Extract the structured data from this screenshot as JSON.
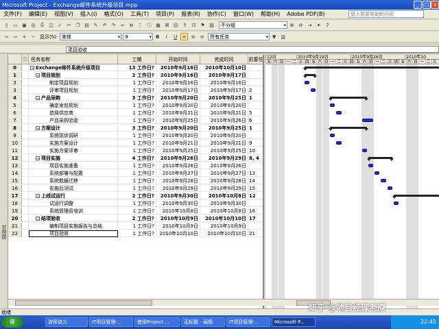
{
  "window": {
    "title": "Microsoft Project - Exchange邮件系统升级项目.mpp"
  },
  "menu": [
    "文件(F)",
    "编辑(E)",
    "视图(V)",
    "插入(I)",
    "格式(O)",
    "工具(T)",
    "项目(P)",
    "报表(R)",
    "协作(C)",
    "窗口(W)",
    "帮助(H)",
    "Adobe PDF(B)"
  ],
  "help_placeholder": "键入需要帮助的问题",
  "toolbar": {
    "group_value": "不分组",
    "show_label": "显示(S)·",
    "font": "宋体",
    "size": "9",
    "filter": "所有任务"
  },
  "entry_bar": {
    "value": "项目验收"
  },
  "columns": {
    "info": "ⓘ",
    "name": "任务名称",
    "duration": "工期",
    "start": "开始时间",
    "finish": "完成时间",
    "pred": "前置任"
  },
  "tasks": [
    {
      "id": "0",
      "name": "Exchange邮件系统升级项目",
      "duration": "13 工作日?",
      "start": "2010年9月16日",
      "finish": "2010年10月10日",
      "pred": "",
      "level": 0,
      "summary": true
    },
    {
      "id": "1",
      "name": "项目规划",
      "duration": "2 工作日?",
      "start": "2010年9月16日",
      "finish": "2010年9月17日",
      "pred": "",
      "level": 1,
      "summary": true
    },
    {
      "id": "2",
      "name": "制定项目规划",
      "duration": "1 工作日?",
      "start": "2010年9月16日",
      "finish": "2010年9月16日",
      "pred": "",
      "level": 2,
      "summary": false
    },
    {
      "id": "3",
      "name": "评审项目规划",
      "duration": "1 工作日?",
      "start": "2010年9月17日",
      "finish": "2010年9月17日",
      "pred": "2",
      "level": 2,
      "summary": false
    },
    {
      "id": "4",
      "name": "产品采购",
      "duration": "3 工作日?",
      "start": "2010年9月20日",
      "finish": "2010年9月25日",
      "pred": "1",
      "level": 1,
      "summary": true
    },
    {
      "id": "5",
      "name": "确定发包规划",
      "duration": "1 工作日?",
      "start": "2010年9月20日",
      "finish": "2010年9月20日",
      "pred": "",
      "level": 2,
      "summary": false
    },
    {
      "id": "6",
      "name": "选择供应商",
      "duration": "1 工作日?",
      "start": "2010年9月21日",
      "finish": "2010年9月21日",
      "pred": "5",
      "level": 2,
      "summary": false
    },
    {
      "id": "7",
      "name": "产品采购验收",
      "duration": "1 工作日?",
      "start": "2010年9月25日",
      "finish": "2010年9月26日",
      "pred": "6",
      "level": 2,
      "summary": false
    },
    {
      "id": "8",
      "name": "方案设计",
      "duration": "3 工作日?",
      "start": "2010年9月20日",
      "finish": "2010年9月25日",
      "pred": "1",
      "level": 1,
      "summary": true
    },
    {
      "id": "9",
      "name": "系统现状调研",
      "duration": "1 工作日?",
      "start": "2010年9月20日",
      "finish": "2010年9月20日",
      "pred": "",
      "level": 2,
      "summary": false
    },
    {
      "id": "10",
      "name": "实施方案设计",
      "duration": "1 工作日?",
      "start": "2010年9月21日",
      "finish": "2010年9月21日",
      "pred": "9",
      "level": 2,
      "summary": false
    },
    {
      "id": "11",
      "name": "实施方案评审",
      "duration": "1 工作日?",
      "start": "2010年9月25日",
      "finish": "2010年9月25日",
      "pred": "10",
      "level": 2,
      "summary": false
    },
    {
      "id": "12",
      "name": "项目实施",
      "duration": "4 工作日?",
      "start": "2010年9月26日",
      "finish": "2010年9月29日",
      "pred": "8, 4",
      "level": 1,
      "summary": true
    },
    {
      "id": "13",
      "name": "项目实施准备",
      "duration": "1 工作日?",
      "start": "2010年9月26日",
      "finish": "2010年9月26日",
      "pred": "",
      "level": 2,
      "summary": false
    },
    {
      "id": "14",
      "name": "系统部署与配置",
      "duration": "1 工作日?",
      "start": "2010年9月27日",
      "finish": "2010年9月27日",
      "pred": "13",
      "level": 2,
      "summary": false
    },
    {
      "id": "15",
      "name": "系统数据迁移",
      "duration": "1 工作日?",
      "start": "2010年9月28日",
      "finish": "2010年9月28日",
      "pred": "14",
      "level": 2,
      "summary": false
    },
    {
      "id": "16",
      "name": "实施后测试",
      "duration": "1 工作日?",
      "start": "2010年9月29日",
      "finish": "2010年9月29日",
      "pred": "15",
      "level": 2,
      "summary": false
    },
    {
      "id": "17",
      "name": "上线试运行",
      "duration": "2 工作日?",
      "start": "2010年9月30日",
      "finish": "2010年10月8日",
      "pred": "12",
      "level": 1,
      "summary": true
    },
    {
      "id": "18",
      "name": "试运行调整",
      "duration": "1 工作日?",
      "start": "2010年9月30日",
      "finish": "2010年9月30日",
      "pred": "",
      "level": 2,
      "summary": false
    },
    {
      "id": "19",
      "name": "系统管理员培训",
      "duration": "1 工作日?",
      "start": "2010年10月8日",
      "finish": "2010年10月8日",
      "pred": "18",
      "level": 2,
      "summary": false
    },
    {
      "id": "20",
      "name": "结项验收",
      "duration": "2 工作日?",
      "start": "2010年10月9日",
      "finish": "2010年10月10日",
      "pred": "17",
      "level": 1,
      "summary": true
    },
    {
      "id": "21",
      "name": "编制项目实施报告与总结",
      "duration": "1 工作日?",
      "start": "2010年10月9日",
      "finish": "2010年10月9日",
      "pred": "",
      "level": 2,
      "summary": false
    },
    {
      "id": "22",
      "name": "项目验收",
      "duration": "1 工作日?",
      "start": "2010年10月10日",
      "finish": "2010年10月10日",
      "pred": "21",
      "level": 2,
      "summary": false
    }
  ],
  "timescale": {
    "weeks": [
      "12日",
      "2010年9月19日",
      "2010年9月26日",
      "2010年10"
    ],
    "days": [
      "五",
      "六",
      "日",
      "一",
      "二",
      "三",
      "四",
      "五",
      "六",
      "日",
      "一",
      "二",
      "三",
      "四",
      "五",
      "六",
      "日",
      "一",
      "二",
      "三",
      "四",
      "五",
      "六",
      "日",
      "一",
      "二",
      "三"
    ]
  },
  "status": {
    "text": "就绪"
  },
  "side_label": "甘特图",
  "taskbar": {
    "items": [
      "讲师讲义",
      "IT项目管理-...",
      "使用Project ...",
      "无标题 - 画图",
      "IT项目管理-...",
      "Microsoft P..."
    ],
    "clock": "22:45"
  },
  "watermark": "知乎 @项目经理老原"
}
